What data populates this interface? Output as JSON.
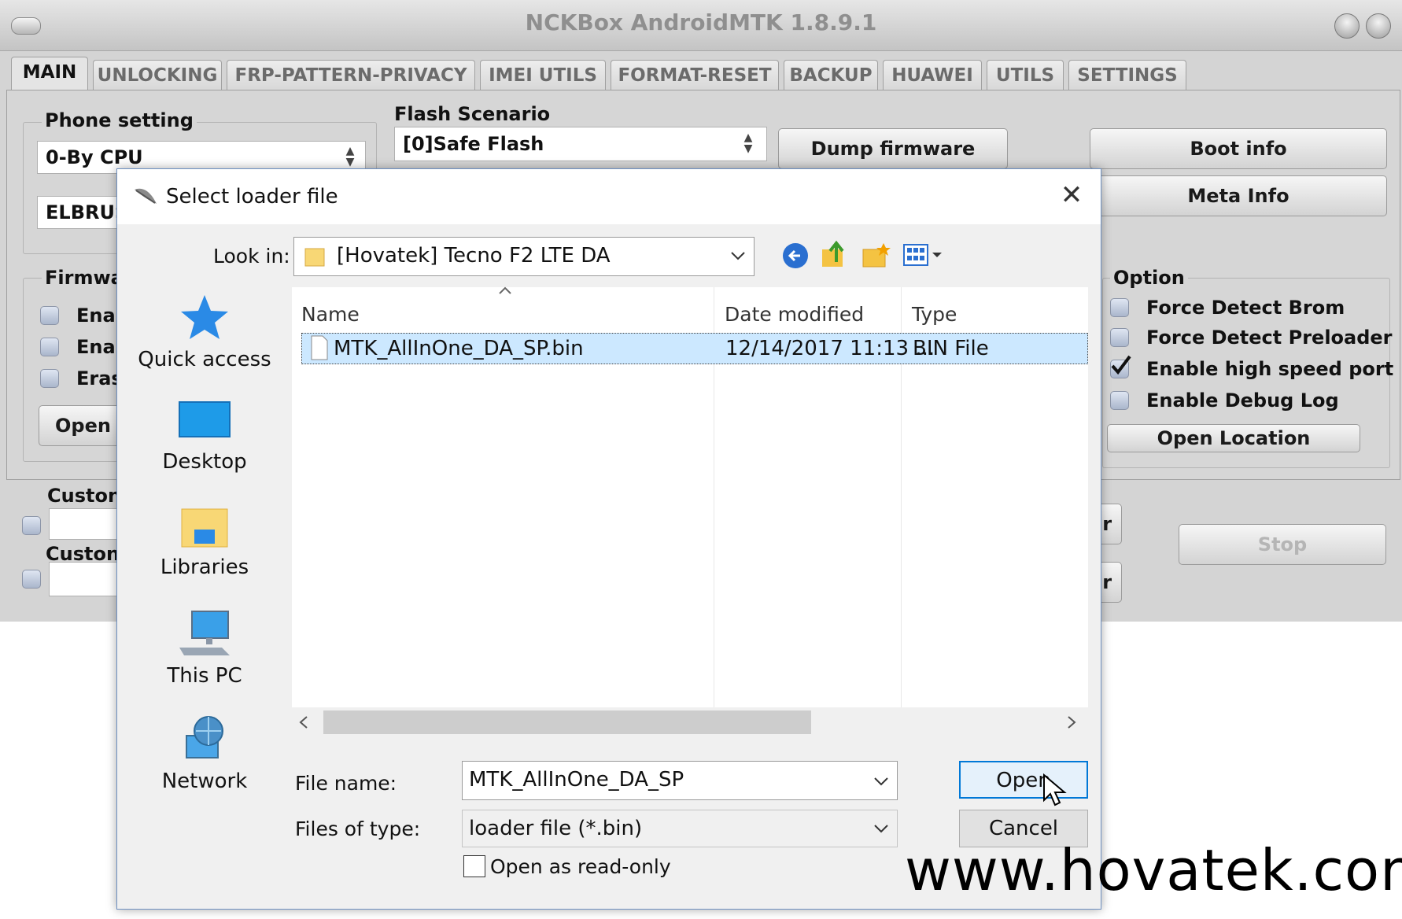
{
  "app": {
    "title": "NCKBox AndroidMTK 1.8.9.1",
    "tabs": [
      "MAIN",
      "UNLOCKING",
      "FRP-PATTERN-PRIVACY",
      "IMEI UTILS",
      "FORMAT-RESET",
      "BACKUP",
      "HUAWEI",
      "UTILS",
      "SETTINGS"
    ],
    "active_tab": "MAIN",
    "phone_setting": {
      "label": "Phone setting",
      "cpu_value": "0-By CPU",
      "platform_value": "ELBRUS"
    },
    "flash_scenario": {
      "label": "Flash Scenario",
      "value": "[0]Safe Flash"
    },
    "buttons": {
      "dump_firmware": "Dump firmware",
      "boot_info": "Boot info",
      "meta_info": "Meta Info",
      "open_location": "Open Location",
      "stop": "Stop",
      "open_partial": "Open s",
      "side_partial_1": "ır",
      "side_partial_2": "ır"
    },
    "firmware_group": {
      "label": "Firmwa",
      "items": [
        "Enal",
        "Enal",
        "Eras"
      ]
    },
    "custom_labels": [
      "Custon",
      "Custon"
    ],
    "option": {
      "label": "Option",
      "items": [
        {
          "label": "Force Detect Brom",
          "checked": false
        },
        {
          "label": "Force Detect Preloader",
          "checked": false
        },
        {
          "label": "Enable high speed port",
          "checked": true
        },
        {
          "label": "Enable Debug Log",
          "checked": false
        }
      ]
    }
  },
  "dialog": {
    "title": "Select loader file",
    "look_in_label": "Look in:",
    "look_in_value": "[Hovatek] Tecno F2 LTE DA",
    "places": [
      "Quick access",
      "Desktop",
      "Libraries",
      "This PC",
      "Network"
    ],
    "columns": [
      "Name",
      "Date modified",
      "Type"
    ],
    "files": [
      {
        "name": "MTK_AllInOne_DA_SP.bin",
        "date": "12/14/2017 11:13 ...",
        "type": "BIN File"
      }
    ],
    "file_name_label": "File name:",
    "file_name_value": "MTK_AllInOne_DA_SP",
    "files_of_type_label": "Files of type:",
    "files_of_type_value": "loader file (*.bin)",
    "read_only_label": "Open as read-only",
    "open_button": "Open",
    "cancel_button": "Cancel"
  },
  "watermark": "www.hovatek.com"
}
